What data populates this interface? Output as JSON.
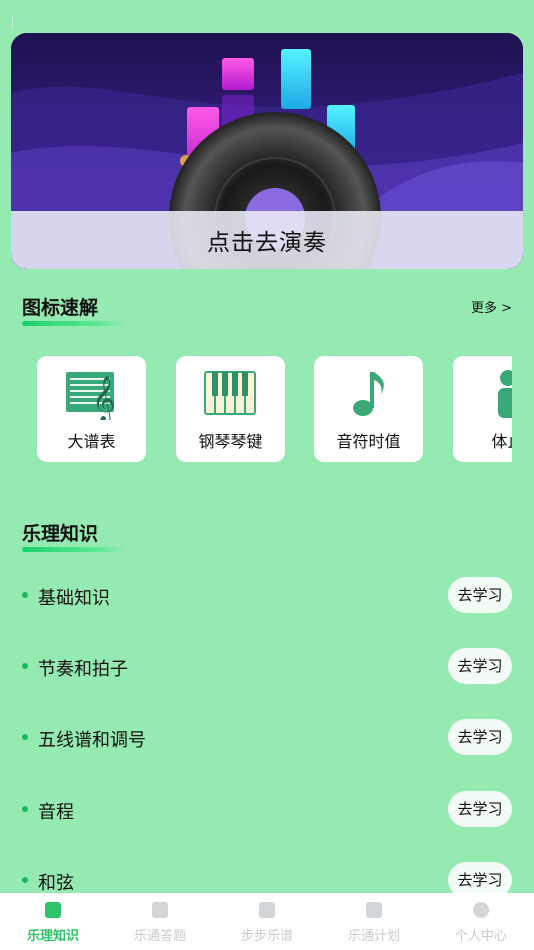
{
  "banner": {
    "caption": "点击去演奏"
  },
  "icon_section": {
    "title": "图标速解",
    "more_label": "更多 >",
    "items": [
      {
        "label": "大谱表",
        "icon": "grand-staff-icon"
      },
      {
        "label": "钢琴琴键",
        "icon": "piano-keys-icon"
      },
      {
        "label": "音符时值",
        "icon": "music-note-icon"
      },
      {
        "label": "体止",
        "icon": "person-icon"
      }
    ]
  },
  "theory_section": {
    "title": "乐理知识",
    "button_label": "去学习",
    "topics": [
      {
        "name": "基础知识"
      },
      {
        "name": "节奏和拍子"
      },
      {
        "name": "五线谱和调号"
      },
      {
        "name": "音程"
      },
      {
        "name": "和弦"
      }
    ]
  },
  "tabbar": {
    "tabs": [
      {
        "label": "乐理知识",
        "icon": "check-square-icon",
        "active": true
      },
      {
        "label": "乐通答题",
        "icon": "document-icon",
        "active": false
      },
      {
        "label": "步步乐谱",
        "icon": "music-sheet-icon",
        "active": false
      },
      {
        "label": "乐通计划",
        "icon": "check-square-icon",
        "active": false
      },
      {
        "label": "个人中心",
        "icon": "user-circle-icon",
        "active": false
      }
    ]
  },
  "colors": {
    "background": "#95eab2",
    "accent": "#2fc46a",
    "icon_green": "#3aa978"
  }
}
